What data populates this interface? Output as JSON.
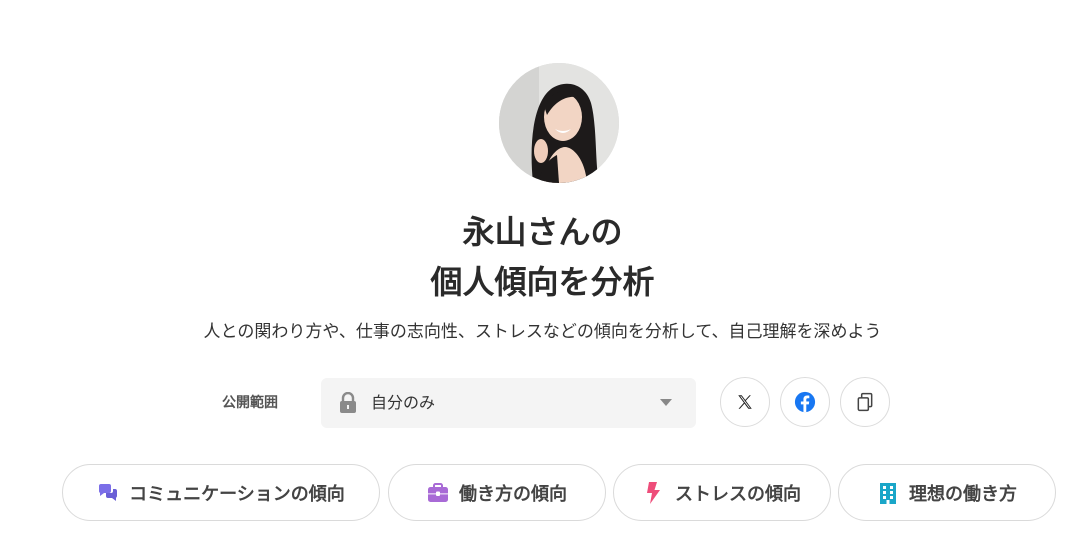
{
  "profile": {
    "title_line1": "永山さんの",
    "title_line2": "個人傾向を分析",
    "subtitle": "人との関わり方や、仕事の志向性、ストレスなどの傾向を分析して、自己理解を深めよう"
  },
  "visibility": {
    "label": "公開範囲",
    "selected": "自分のみ",
    "icon": "lock-icon"
  },
  "share": [
    {
      "name": "x",
      "icon": "x-logo-icon"
    },
    {
      "name": "facebook",
      "icon": "facebook-icon",
      "color": "#1877f2"
    },
    {
      "name": "copy",
      "icon": "copy-icon"
    }
  ],
  "categories": [
    {
      "label": "コミュニケーションの傾向",
      "icon": "speech-bubbles-icon",
      "color": "#7b6ee8"
    },
    {
      "label": "働き方の傾向",
      "icon": "briefcase-icon",
      "color": "#a86ad6"
    },
    {
      "label": "ストレスの傾向",
      "icon": "lightning-icon",
      "color": "#ee4d7a"
    },
    {
      "label": "理想の働き方",
      "icon": "building-icon",
      "color": "#1aa6c8"
    }
  ]
}
